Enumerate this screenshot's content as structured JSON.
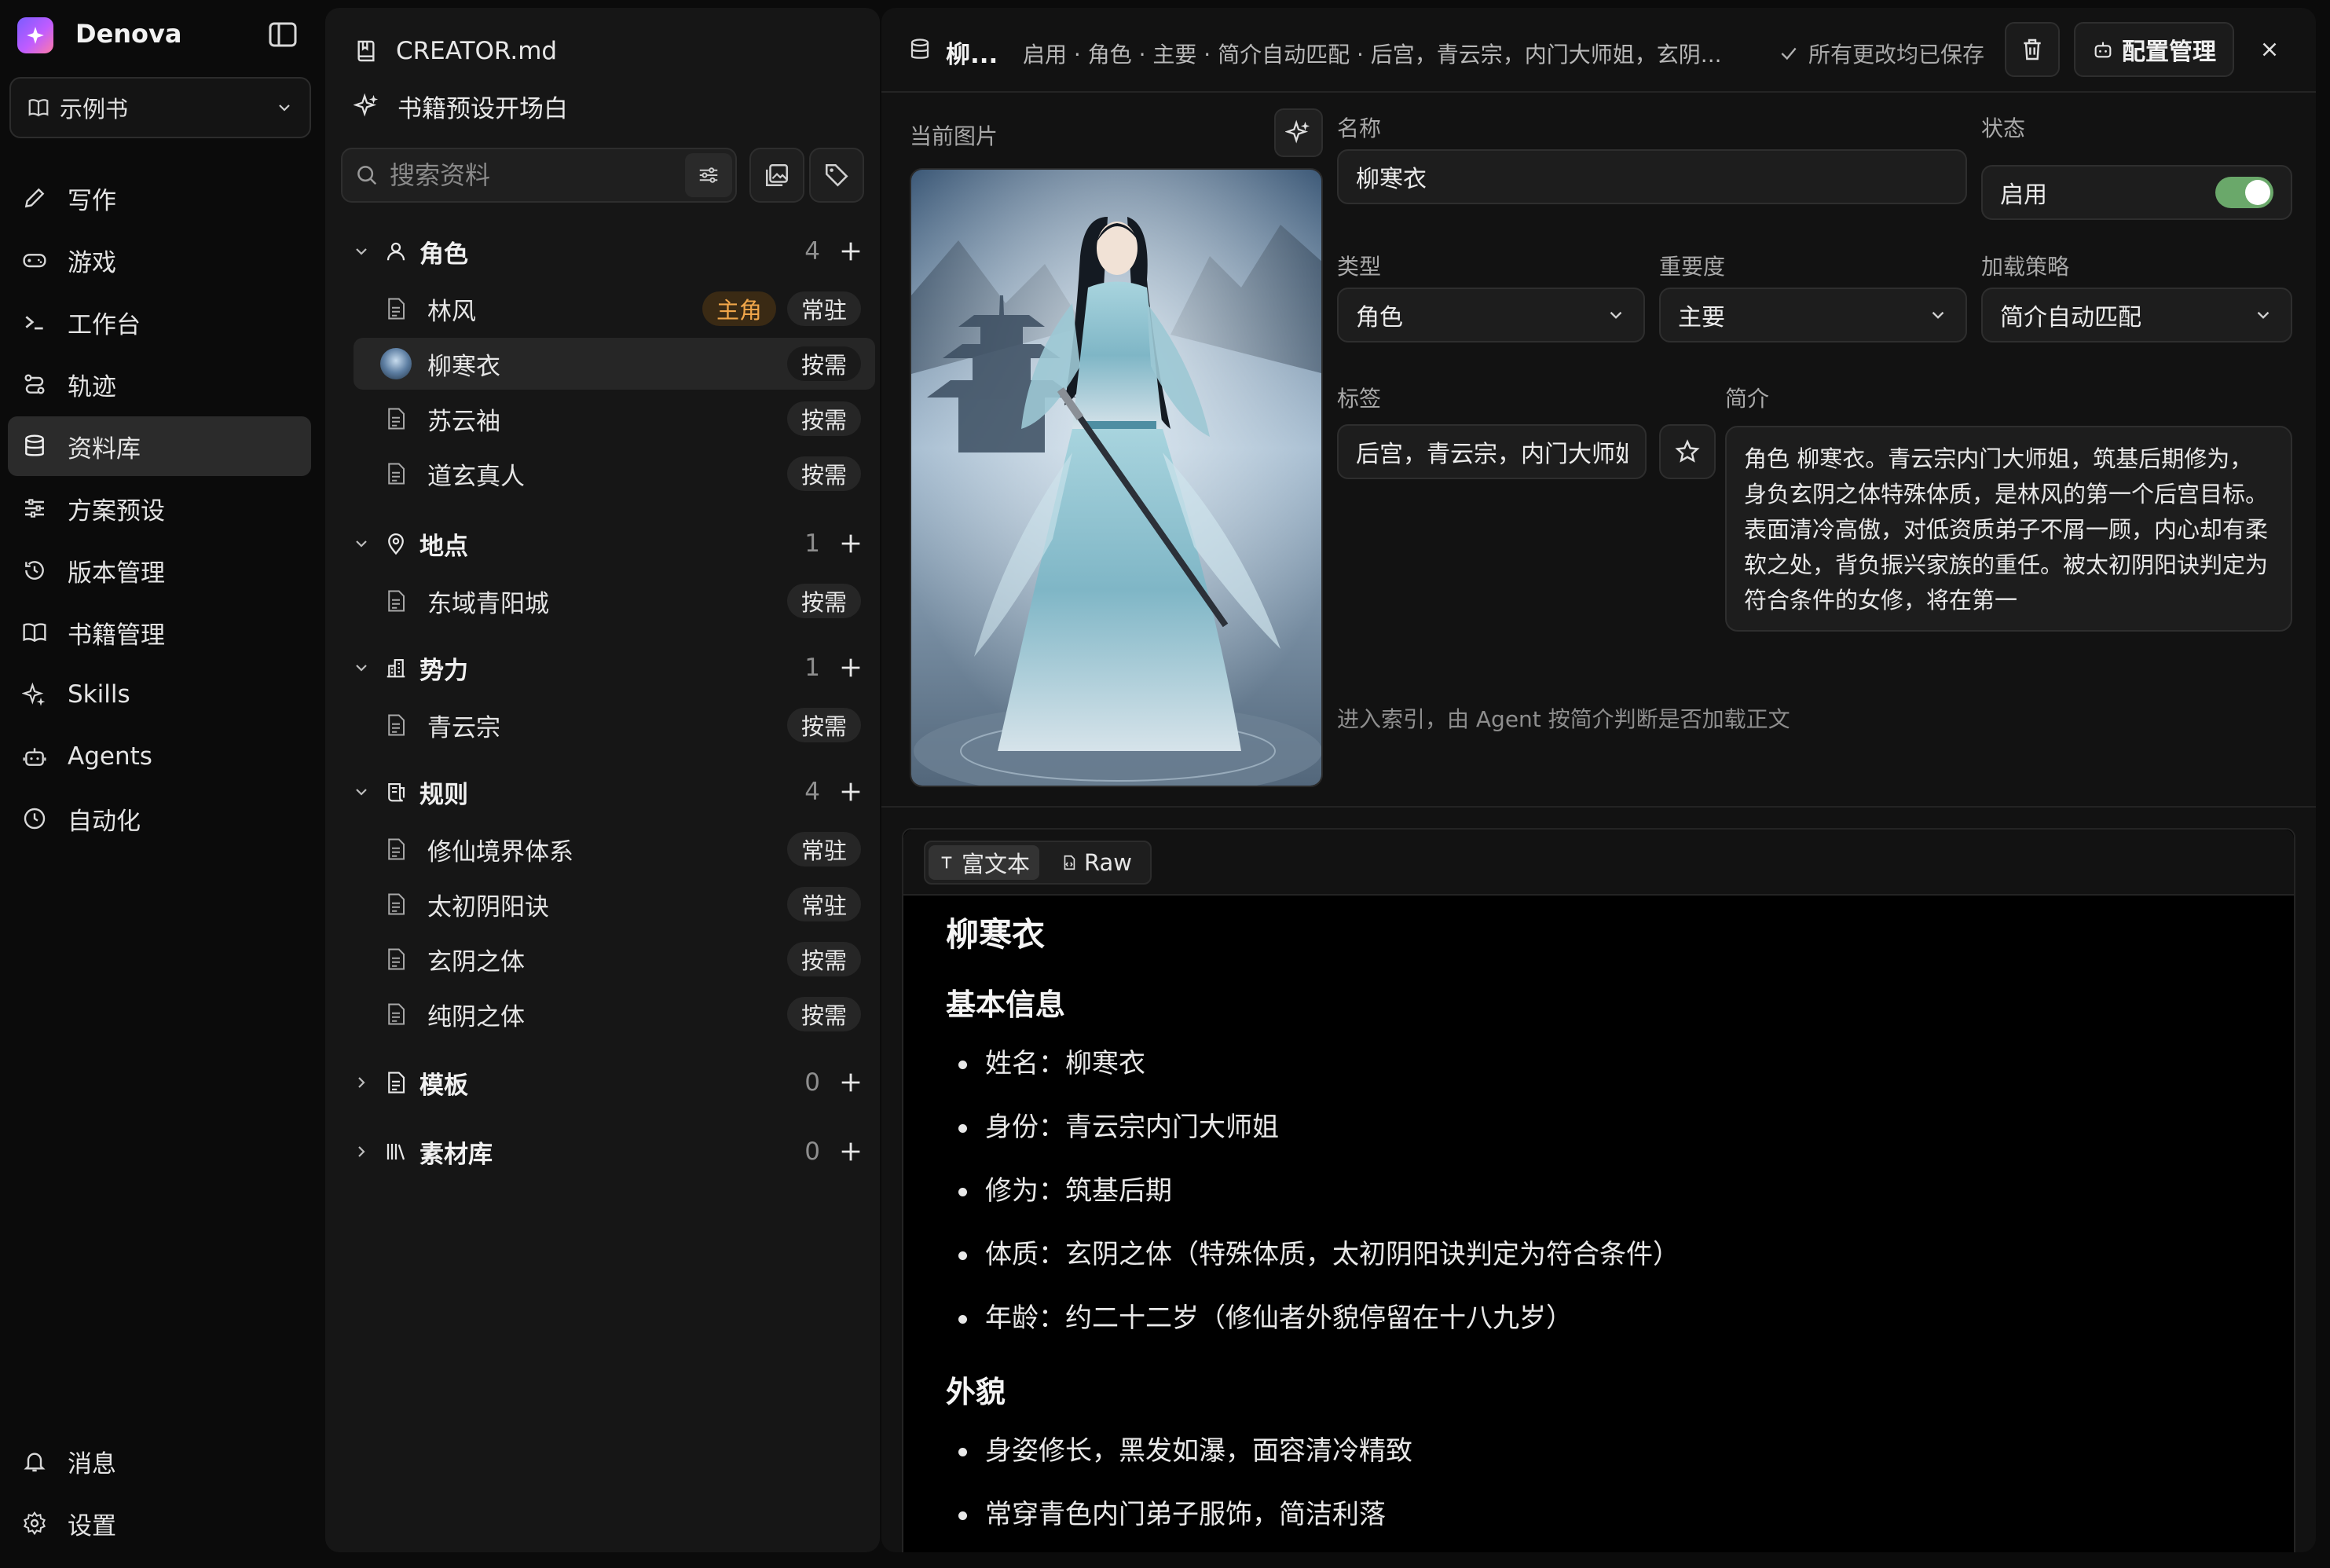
{
  "app": {
    "name": "Denova"
  },
  "book_selector": {
    "label": "示例书"
  },
  "nav": {
    "items": [
      {
        "label": "写作",
        "icon": "pen-icon"
      },
      {
        "label": "游戏",
        "icon": "gamepad-icon"
      },
      {
        "label": "工作台",
        "icon": "terminal-icon"
      },
      {
        "label": "轨迹",
        "icon": "route-icon"
      },
      {
        "label": "资料库",
        "icon": "database-icon",
        "active": true
      },
      {
        "label": "方案预设",
        "icon": "sliders-icon"
      },
      {
        "label": "版本管理",
        "icon": "history-icon"
      },
      {
        "label": "书籍管理",
        "icon": "book-open-icon"
      },
      {
        "label": "Skills",
        "icon": "sparkles-icon"
      },
      {
        "label": "Agents",
        "icon": "bot-icon"
      },
      {
        "label": "自动化",
        "icon": "clock-icon"
      }
    ],
    "bottom": [
      {
        "label": "消息",
        "icon": "bell-icon"
      },
      {
        "label": "设置",
        "icon": "gear-icon"
      }
    ]
  },
  "panel": {
    "creator_file": "CREATOR.md",
    "opening": "书籍预设开场白",
    "search_placeholder": "搜索资料",
    "groups": {
      "characters": {
        "name": "角色",
        "count": "4",
        "entries": [
          {
            "name": "林风",
            "badges": [
              "主角",
              "常驻"
            ]
          },
          {
            "name": "柳寒衣",
            "badges": [
              "按需"
            ],
            "active": true
          },
          {
            "name": "苏云袖",
            "badges": [
              "按需"
            ]
          },
          {
            "name": "道玄真人",
            "badges": [
              "按需"
            ]
          }
        ]
      },
      "places": {
        "name": "地点",
        "count": "1",
        "entries": [
          {
            "name": "东域青阳城",
            "badge": "按需"
          }
        ]
      },
      "factions": {
        "name": "势力",
        "count": "1",
        "entries": [
          {
            "name": "青云宗",
            "badge": "按需"
          }
        ]
      },
      "rules": {
        "name": "规则",
        "count": "4",
        "entries": [
          {
            "name": "修仙境界体系",
            "badge": "常驻"
          },
          {
            "name": "太初阴阳诀",
            "badge": "常驻"
          },
          {
            "name": "玄阴之体",
            "badge": "按需"
          },
          {
            "name": "纯阴之体",
            "badge": "按需"
          }
        ]
      },
      "templates": {
        "name": "模板",
        "count": "0"
      },
      "materials": {
        "name": "素材库",
        "count": "0"
      }
    }
  },
  "detail": {
    "title": "柳...",
    "meta": "启用 · 角色 · 主要 · 简介自动匹配 · 后宫，青云宗，内门大师姐，玄阴...",
    "saved": "所有更改均已保存",
    "config_button": "配置管理",
    "image_label": "当前图片",
    "name_label": "名称",
    "name_value": "柳寒衣",
    "status_label": "状态",
    "status_value": "启用",
    "type_label": "类型",
    "type_value": "角色",
    "importance_label": "重要度",
    "importance_value": "主要",
    "strategy_label": "加载策略",
    "strategy_value": "简介自动匹配",
    "tags_label": "标签",
    "tags_value": "后宫，青云宗，内门大师姐",
    "summary_label": "简介",
    "summary_value": "角色 柳寒衣。青云宗内门大师姐，筑基后期修为，身负玄阴之体特殊体质，是林风的第一个后宫目标。表面清冷高傲，对低资质弟子不屑一顾，内心却有柔软之处，背负振兴家族的重任。被太初阴阳诀判定为符合条件的女修，将在第一",
    "hint": "进入索引，由 Agent 按简介判断是否加载正文"
  },
  "editor": {
    "tab_rich": "富文本",
    "tab_raw": "Raw",
    "doc": {
      "h1": "柳寒衣",
      "sec1_title": "基本信息",
      "sec1_items": [
        "姓名：柳寒衣",
        "身份：青云宗内门大师姐",
        "修为：筑基后期",
        "体质：玄阴之体（特殊体质，太初阴阳诀判定为符合条件）",
        "年龄：约二十二岁（修仙者外貌停留在十八九岁）"
      ],
      "sec2_title": "外貌",
      "sec2_items": [
        "身姿修长，黑发如瀑，面容清冷精致",
        "常穿青色内门弟子服饰，简洁利落"
      ]
    }
  },
  "colors": {
    "accent_orange": "#f0a64a",
    "toggle_green": "#6aa86a",
    "active_bg": "#2b2b2b"
  }
}
